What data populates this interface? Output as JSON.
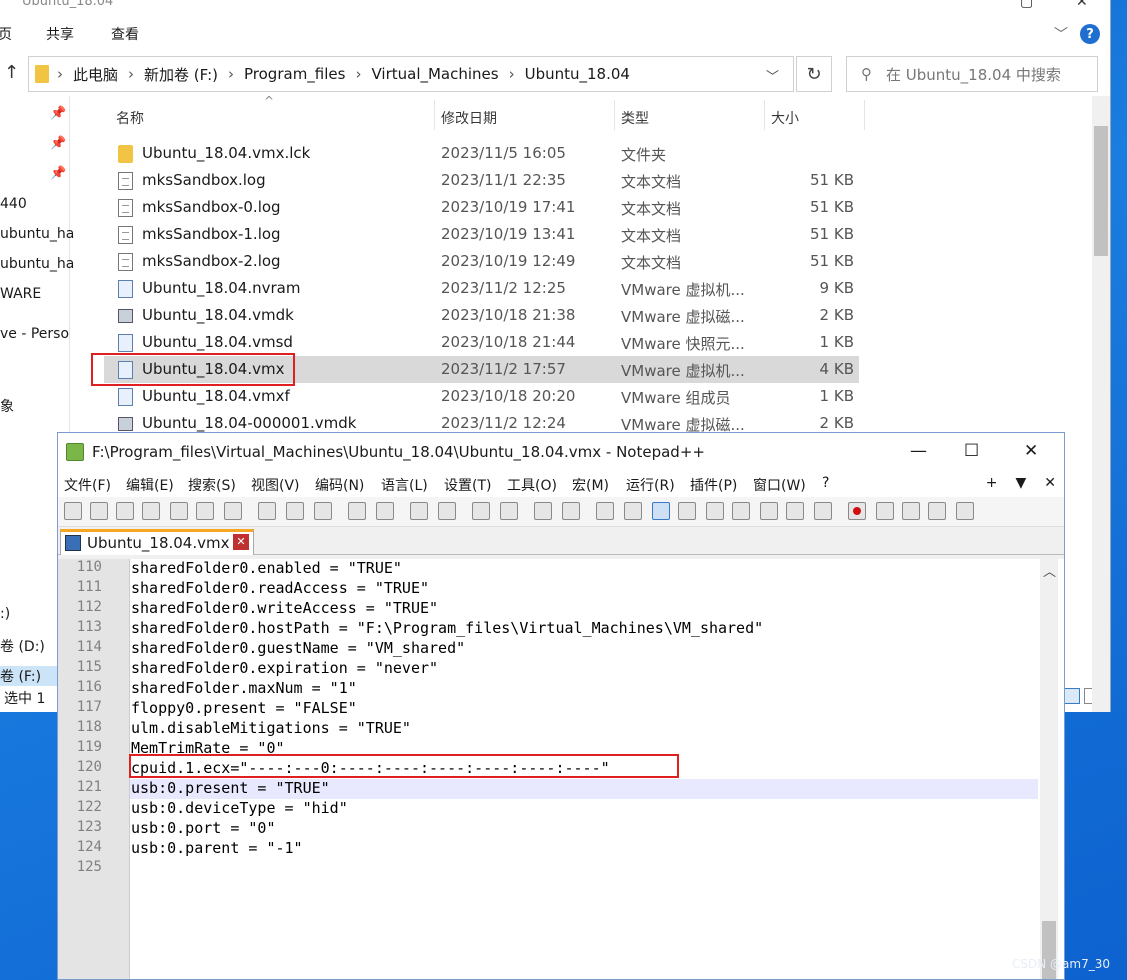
{
  "explorer": {
    "title_partial": "Ubuntu_18.04",
    "ribbon_tabs": [
      "页",
      "共享",
      "查看"
    ],
    "breadcrumbs": [
      "此电脑",
      "新加卷 (F:)",
      "Program_files",
      "Virtual_Machines",
      "Ubuntu_18.04"
    ],
    "search_placeholder": "在 Ubuntu_18.04 中搜索",
    "nav_items": [
      "440",
      "ubuntu_ha",
      "ubuntu_ha",
      "WARE",
      "ve - Perso",
      "象",
      ":)",
      "卷 (D:)",
      "卷 (F:)"
    ],
    "columns": {
      "name": "名称",
      "date": "修改日期",
      "type": "类型",
      "size": "大小"
    },
    "files": [
      {
        "name": "Ubuntu_18.04.vmx.lck",
        "date": "2023/11/5 16:05",
        "type": "文件夹",
        "size": "",
        "icon": "folder-icon"
      },
      {
        "name": "mksSandbox.log",
        "date": "2023/11/1 22:35",
        "type": "文本文档",
        "size": "51 KB",
        "icon": "document-icon"
      },
      {
        "name": "mksSandbox-0.log",
        "date": "2023/10/19 17:41",
        "type": "文本文档",
        "size": "51 KB",
        "icon": "document-icon"
      },
      {
        "name": "mksSandbox-1.log",
        "date": "2023/10/19 13:41",
        "type": "文本文档",
        "size": "51 KB",
        "icon": "document-icon"
      },
      {
        "name": "mksSandbox-2.log",
        "date": "2023/10/19 12:49",
        "type": "文本文档",
        "size": "51 KB",
        "icon": "document-icon"
      },
      {
        "name": "Ubuntu_18.04.nvram",
        "date": "2023/11/2 12:25",
        "type": "VMware 虚拟机...",
        "size": "9 KB",
        "icon": "vm-file-icon"
      },
      {
        "name": "Ubuntu_18.04.vmdk",
        "date": "2023/10/18 21:38",
        "type": "VMware 虚拟磁...",
        "size": "2 KB",
        "icon": "disk-icon"
      },
      {
        "name": "Ubuntu_18.04.vmsd",
        "date": "2023/10/18 21:44",
        "type": "VMware 快照元...",
        "size": "1 KB",
        "icon": "vm-file-icon"
      },
      {
        "name": "Ubuntu_18.04.vmx",
        "date": "2023/11/2 17:57",
        "type": "VMware 虚拟机...",
        "size": "4 KB",
        "icon": "vm-file-icon",
        "selected": true
      },
      {
        "name": "Ubuntu_18.04.vmxf",
        "date": "2023/10/18 20:20",
        "type": "VMware 组成员",
        "size": "1 KB",
        "icon": "vm-file-icon"
      },
      {
        "name": "Ubuntu_18.04-000001.vmdk",
        "date": "2023/11/2 12:24",
        "type": "VMware 虚拟磁...",
        "size": "2 KB",
        "icon": "disk-icon"
      }
    ],
    "status": "选中 1"
  },
  "npp": {
    "title": "F:\\Program_files\\Virtual_Machines\\Ubuntu_18.04\\Ubuntu_18.04.vmx - Notepad++",
    "menu": [
      "文件(F)",
      "编辑(E)",
      "搜索(S)",
      "视图(V)",
      "编码(N)",
      "语言(L)",
      "设置(T)",
      "工具(O)",
      "宏(M)",
      "运行(R)",
      "插件(P)",
      "窗口(W)",
      "?"
    ],
    "menu_right": [
      "+",
      "▼",
      "✕"
    ],
    "tab_label": "Ubuntu_18.04.vmx",
    "lines": [
      {
        "n": "110",
        "text": "sharedFolder0.enabled = \"TRUE\""
      },
      {
        "n": "111",
        "text": "sharedFolder0.readAccess = \"TRUE\""
      },
      {
        "n": "112",
        "text": "sharedFolder0.writeAccess = \"TRUE\""
      },
      {
        "n": "113",
        "text": "sharedFolder0.hostPath = \"F:\\Program_files\\Virtual_Machines\\VM_shared\""
      },
      {
        "n": "114",
        "text": "sharedFolder0.guestName = \"VM_shared\""
      },
      {
        "n": "115",
        "text": "sharedFolder0.expiration = \"never\""
      },
      {
        "n": "116",
        "text": "sharedFolder.maxNum = \"1\""
      },
      {
        "n": "117",
        "text": "floppy0.present = \"FALSE\""
      },
      {
        "n": "118",
        "text": "ulm.disableMitigations = \"TRUE\""
      },
      {
        "n": "119",
        "text": "MemTrimRate = \"0\""
      },
      {
        "n": "120",
        "text": "cpuid.1.ecx=\"----:---0:----:----:----:----:----:----\""
      },
      {
        "n": "121",
        "text": "usb:0.present = \"TRUE\""
      },
      {
        "n": "122",
        "text": "usb:0.deviceType = \"hid\""
      },
      {
        "n": "123",
        "text": "usb:0.port = \"0\""
      },
      {
        "n": "124",
        "text": "usb:0.parent = \"-1\""
      },
      {
        "n": "125",
        "text": ""
      }
    ]
  },
  "watermark": "CSDN @am7_30"
}
